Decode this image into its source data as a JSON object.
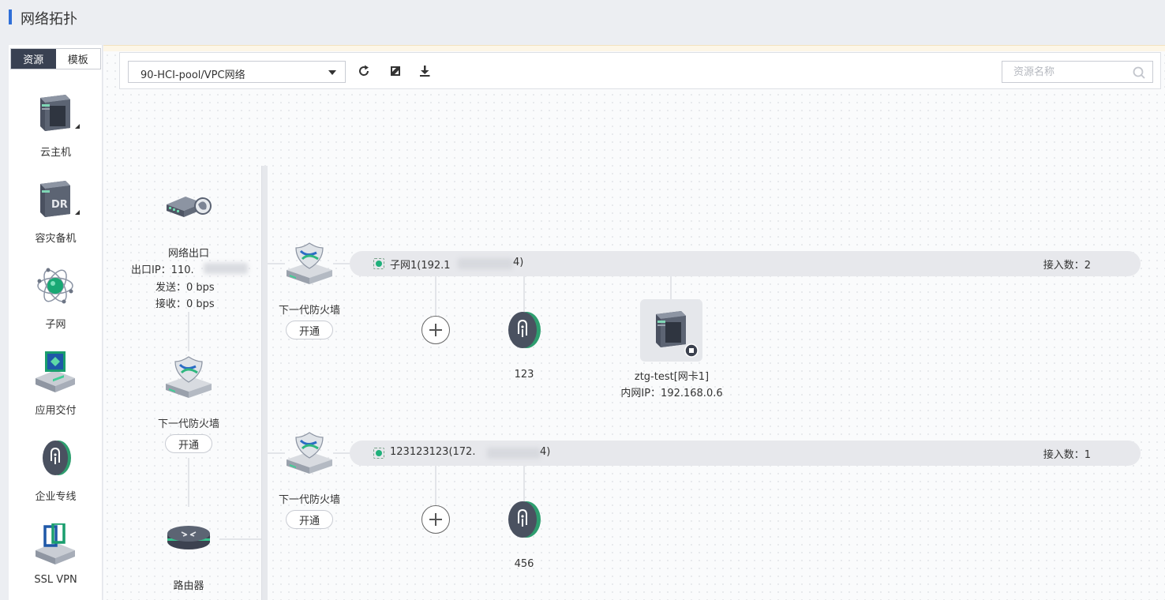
{
  "page": {
    "title": "网络拓扑"
  },
  "palette": {
    "tabs": [
      {
        "label": "资源"
      },
      {
        "label": "模板"
      }
    ],
    "items": [
      {
        "label": "云主机",
        "icon": "cloud-host-icon"
      },
      {
        "label": "容灾备机",
        "icon": "dr-backup-host-icon"
      },
      {
        "label": "子网",
        "icon": "subnet-icon"
      },
      {
        "label": "应用交付",
        "icon": "app-delivery-icon"
      },
      {
        "label": "企业专线",
        "icon": "enterprise-line-icon"
      },
      {
        "label": "SSL VPN",
        "icon": "ssl-vpn-icon"
      }
    ]
  },
  "toolbar": {
    "network_select": "90-HCI-pool/VPC网络",
    "search_placeholder": "资源名称"
  },
  "topology": {
    "egress": {
      "label": "网络出口",
      "ip_prefix": "出口IP：110.",
      "send": "发送：0 bps",
      "recv": "接收：0 bps"
    },
    "firewalls": [
      {
        "label": "下一代防火墙",
        "button": "开通"
      },
      {
        "label": "下一代防火墙",
        "button": "开通"
      },
      {
        "label": "下一代防火墙",
        "button": "开通"
      }
    ],
    "router": {
      "label": "路由器"
    },
    "subnets": [
      {
        "name_prefix": "子网1(192.1",
        "name_suffix": "4)",
        "count": "接入数：2"
      },
      {
        "name_prefix": "123123123(172.",
        "name_suffix": "4)",
        "count": "接入数：1"
      }
    ],
    "lines": [
      {
        "label": "123"
      },
      {
        "label": "456"
      }
    ],
    "vm": {
      "name": "ztg-test[网卡1]",
      "ip": "内网IP：192.168.0.6"
    }
  },
  "colors": {
    "accent": "#2f6fd8",
    "tab_active": "#394152",
    "subnet_dot": "#1fb07a"
  }
}
